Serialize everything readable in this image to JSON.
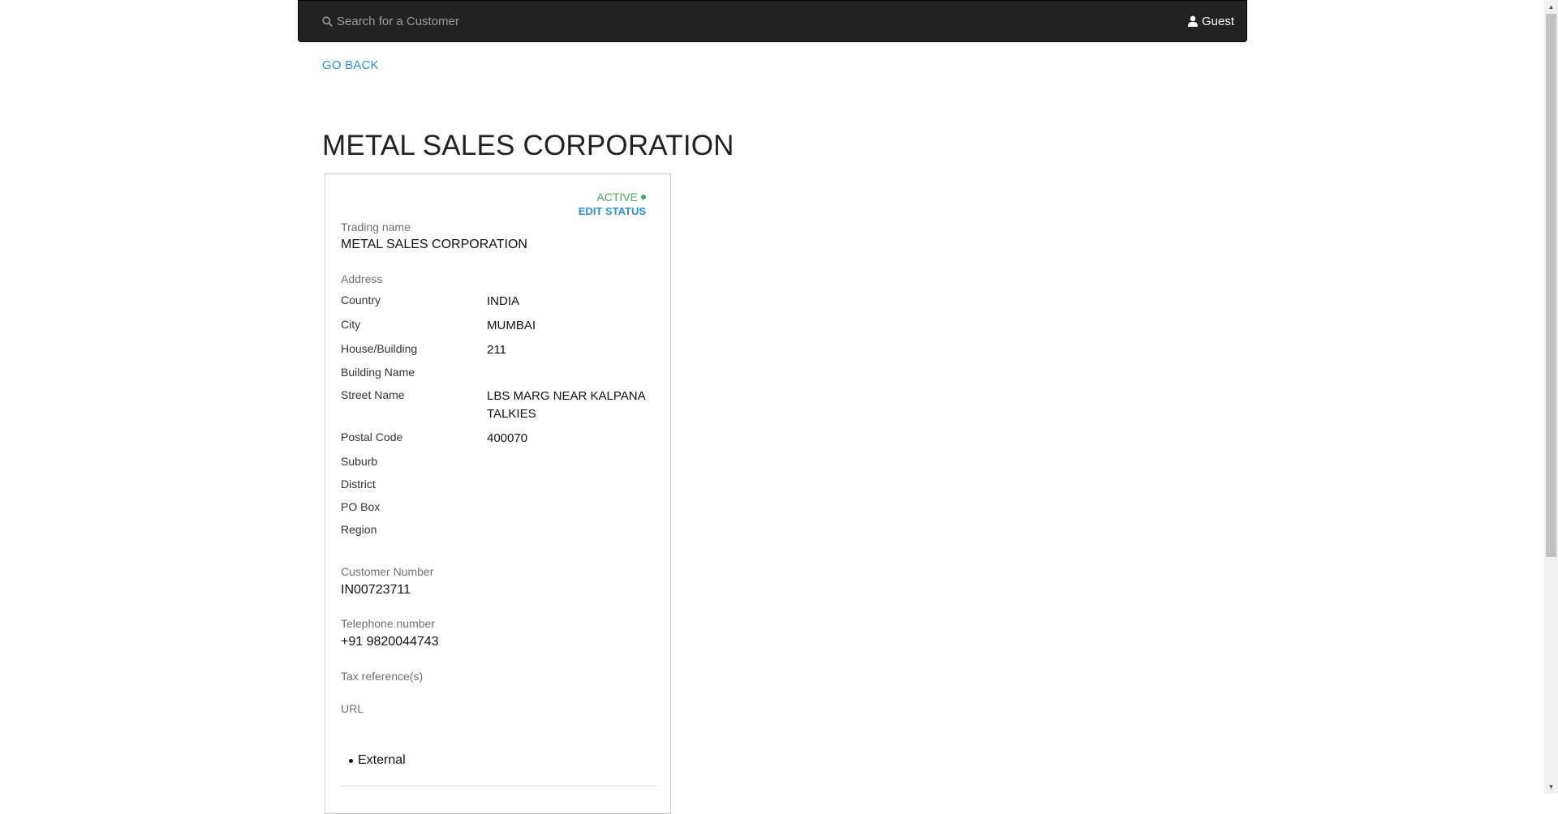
{
  "navbar": {
    "search_placeholder": "Search for a Customer",
    "search_icon": "search-icon",
    "user_label": "Guest",
    "user_icon": "user-icon"
  },
  "nav": {
    "go_back": "GO BACK"
  },
  "page": {
    "title": "METAL SALES CORPORATION"
  },
  "status": {
    "label": "ACTIVE",
    "edit": "EDIT STATUS",
    "color": "#3cab57"
  },
  "trading": {
    "label": "Trading name",
    "value": "METAL SALES CORPORATION"
  },
  "address": {
    "heading": "Address",
    "rows": [
      {
        "label": "Country",
        "value": "INDIA"
      },
      {
        "label": "City",
        "value": "MUMBAI"
      },
      {
        "label": "House/Building",
        "value": "211"
      },
      {
        "label": "Building Name",
        "value": ""
      },
      {
        "label": "Street Name",
        "value": "LBS MARG NEAR KALPANA TALKIES"
      },
      {
        "label": "Postal Code",
        "value": "400070"
      },
      {
        "label": "Suburb",
        "value": ""
      },
      {
        "label": "District",
        "value": ""
      },
      {
        "label": "PO Box",
        "value": ""
      },
      {
        "label": "Region",
        "value": ""
      }
    ]
  },
  "customer_number": {
    "label": "Customer Number",
    "value": "IN00723711"
  },
  "telephone": {
    "label": "Telephone number",
    "value": "+91 9820044743"
  },
  "tax": {
    "label": "Tax reference(s)"
  },
  "url": {
    "label": "URL"
  },
  "classification": {
    "label": "External"
  },
  "colors": {
    "accent": "#2a8fd6",
    "navbar": "#222222"
  }
}
